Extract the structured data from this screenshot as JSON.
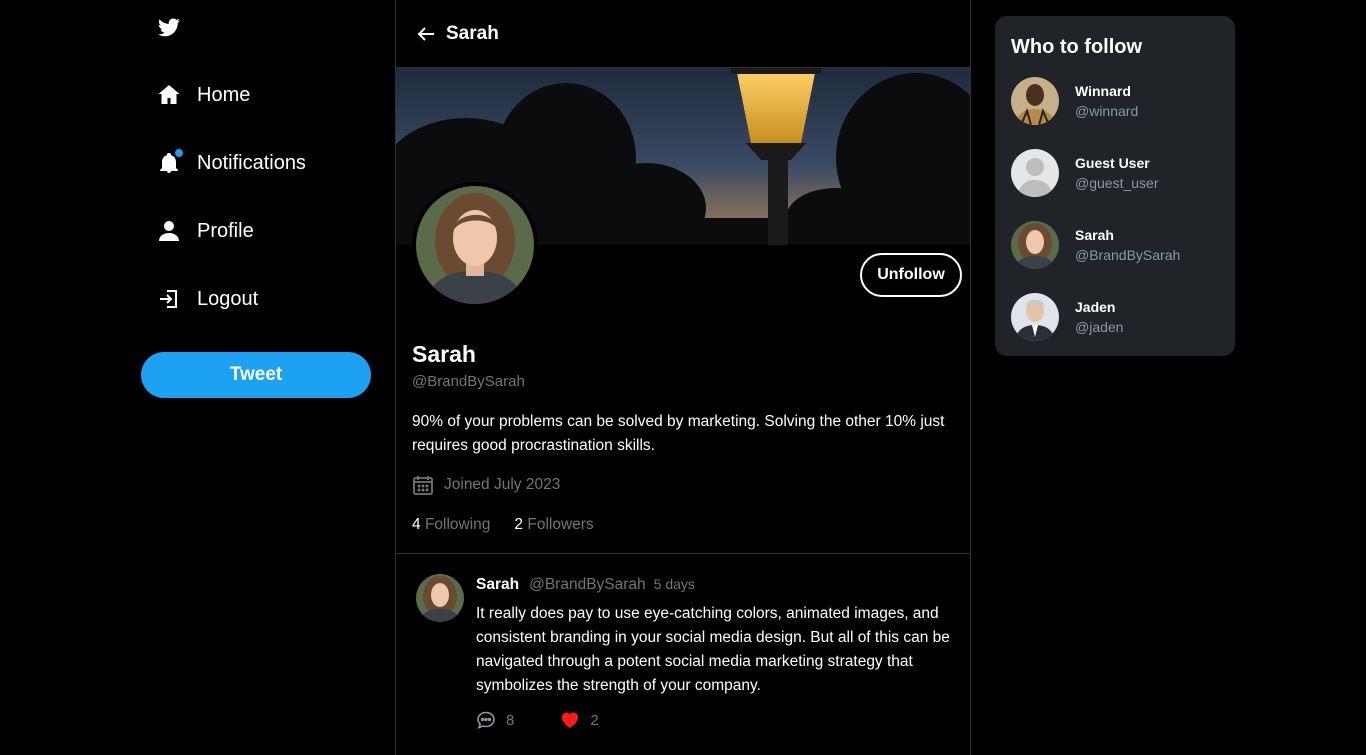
{
  "nav": {
    "items": [
      {
        "label": "Home",
        "icon": "home-icon"
      },
      {
        "label": "Notifications",
        "icon": "bell-icon"
      },
      {
        "label": "Profile",
        "icon": "user-icon"
      },
      {
        "label": "Logout",
        "icon": "logout-icon"
      }
    ],
    "tweet_button": "Tweet",
    "accent": "#1da1f2"
  },
  "header": {
    "title": "Sarah"
  },
  "profile": {
    "name": "Sarah",
    "handle": "@BrandBySarah",
    "bio": "90% of your problems can be solved by marketing. Solving the other 10% just requires good procrastination skills.",
    "joined": "Joined July 2023",
    "following_count": "4",
    "following_label": "Following",
    "followers_count": "2",
    "followers_label": "Followers",
    "unfollow_label": "Unfollow"
  },
  "tweet": {
    "name": "Sarah",
    "handle": "@BrandBySarah",
    "time": "5 days",
    "body": "It really does pay to use eye-catching colors, animated images, and consistent branding in your social media design. But all of this can be navigated through a potent social media marketing strategy that symbolizes the strength of your company.",
    "comments": "8",
    "likes": "2",
    "like_color": "#f91880"
  },
  "who_to_follow": {
    "title": "Who to follow",
    "users": [
      {
        "name": "Winnard",
        "handle": "@winnard"
      },
      {
        "name": "Guest User",
        "handle": "@guest_user"
      },
      {
        "name": "Sarah",
        "handle": "@BrandBySarah"
      },
      {
        "name": "Jaden",
        "handle": "@jaden"
      }
    ]
  }
}
